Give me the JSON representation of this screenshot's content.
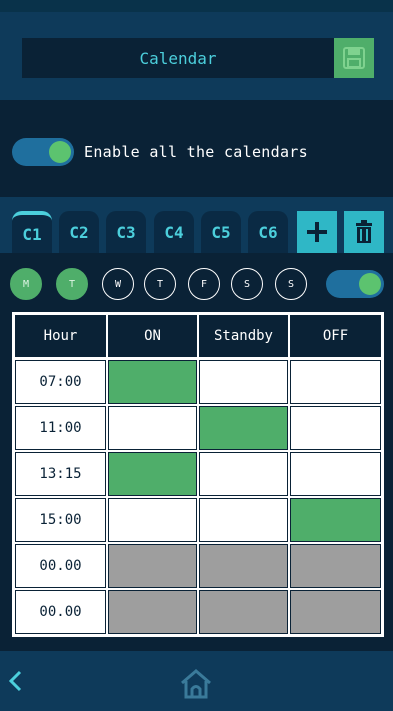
{
  "header": {
    "title": "Calendar",
    "save_icon": "floppy-disk-icon"
  },
  "enable": {
    "label": "Enable all the calendars",
    "checked": true
  },
  "tabs": [
    {
      "label": "C1",
      "active": true
    },
    {
      "label": "C2",
      "active": false
    },
    {
      "label": "C3",
      "active": false
    },
    {
      "label": "C4",
      "active": false
    },
    {
      "label": "C5",
      "active": false
    },
    {
      "label": "C6",
      "active": false
    }
  ],
  "tab_actions": {
    "add_icon": "plus-icon",
    "delete_icon": "trash-icon"
  },
  "days": [
    {
      "label": "M",
      "selected": true
    },
    {
      "label": "T",
      "selected": true
    },
    {
      "label": "W",
      "selected": false
    },
    {
      "label": "T",
      "selected": false
    },
    {
      "label": "F",
      "selected": false
    },
    {
      "label": "S",
      "selected": false
    },
    {
      "label": "S",
      "selected": false
    }
  ],
  "days_toggle": {
    "checked": true
  },
  "schedule": {
    "headers": [
      "Hour",
      "ON",
      "Standby",
      "OFF"
    ],
    "rows": [
      {
        "hour": "07:00",
        "state": "ON"
      },
      {
        "hour": "11:00",
        "state": "Standby"
      },
      {
        "hour": "13:15",
        "state": "ON"
      },
      {
        "hour": "15:00",
        "state": "OFF"
      },
      {
        "hour": "00.00",
        "state": "disabled"
      },
      {
        "hour": "00.00",
        "state": "disabled"
      }
    ]
  },
  "colors": {
    "background": "#0a2236",
    "panel": "#0e3a5a",
    "accent": "#4ccfdc",
    "active_green": "#4fae6a",
    "disabled_gray": "#9e9e9e"
  },
  "bottom": {
    "back_icon": "chevron-left-icon",
    "home_icon": "home-icon"
  }
}
